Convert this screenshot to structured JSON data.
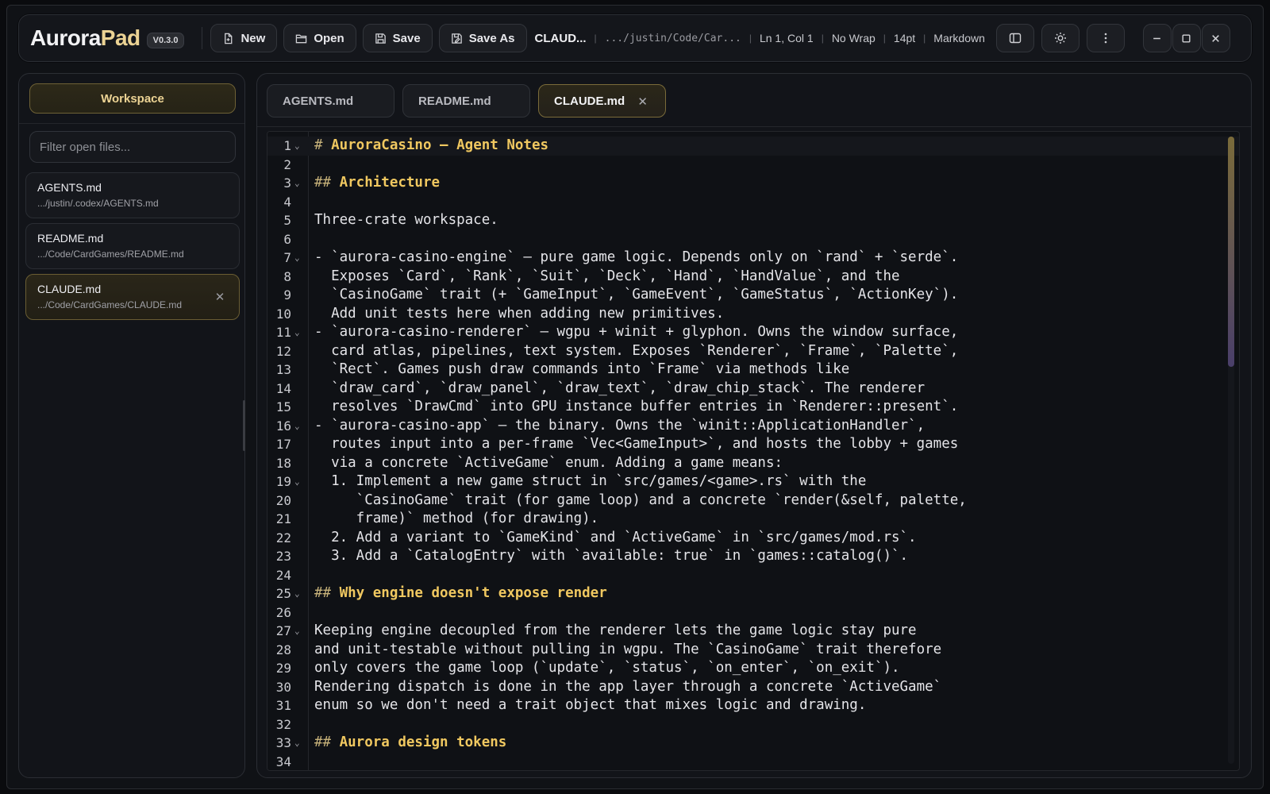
{
  "app": {
    "name_part1": "Aurora",
    "name_part2": "Pad",
    "version": "V0.3.0"
  },
  "toolbar": {
    "new_label": "New",
    "open_label": "Open",
    "save_label": "Save",
    "save_as_label": "Save As"
  },
  "status": {
    "file_name": "CLAUD...",
    "path": ".../justin/Code/Car...",
    "cursor": "Ln 1, Col 1",
    "wrap": "No Wrap",
    "font_size": "14pt",
    "language": "Markdown"
  },
  "sidebar": {
    "workspace_label": "Workspace",
    "filter_placeholder": "Filter open files...",
    "files": [
      {
        "name": "AGENTS.md",
        "path": ".../justin/.codex/AGENTS.md"
      },
      {
        "name": "README.md",
        "path": ".../Code/CardGames/README.md"
      },
      {
        "name": "CLAUDE.md",
        "path": ".../Code/CardGames/CLAUDE.md"
      }
    ]
  },
  "tabs": [
    {
      "label": "AGENTS.md"
    },
    {
      "label": "README.md"
    },
    {
      "label": "CLAUDE.md"
    }
  ],
  "colors": {
    "accent_gold": "#ecd394",
    "heading": "#f0c860",
    "background": "#101216"
  },
  "editor": {
    "lines": [
      {
        "n": "1",
        "fold": true,
        "heading": true,
        "marker": "#",
        "text": "AuroraCasino — Agent Notes"
      },
      {
        "n": "2",
        "text": ""
      },
      {
        "n": "3",
        "fold": true,
        "heading": true,
        "marker": "##",
        "text": "Architecture"
      },
      {
        "n": "4",
        "text": ""
      },
      {
        "n": "5",
        "text": "Three-crate workspace."
      },
      {
        "n": "6",
        "text": ""
      },
      {
        "n": "7",
        "fold": true,
        "text": "- `aurora-casino-engine` — pure game logic. Depends only on `rand` + `serde`."
      },
      {
        "n": "8",
        "text": "  Exposes `Card`, `Rank`, `Suit`, `Deck`, `Hand`, `HandValue`, and the"
      },
      {
        "n": "9",
        "text": "  `CasinoGame` trait (+ `GameInput`, `GameEvent`, `GameStatus`, `ActionKey`)."
      },
      {
        "n": "10",
        "text": "  Add unit tests here when adding new primitives."
      },
      {
        "n": "11",
        "fold": true,
        "text": "- `aurora-casino-renderer` — wgpu + winit + glyphon. Owns the window surface,"
      },
      {
        "n": "12",
        "text": "  card atlas, pipelines, text system. Exposes `Renderer`, `Frame`, `Palette`,"
      },
      {
        "n": "13",
        "text": "  `Rect`. Games push draw commands into `Frame` via methods like"
      },
      {
        "n": "14",
        "text": "  `draw_card`, `draw_panel`, `draw_text`, `draw_chip_stack`. The renderer"
      },
      {
        "n": "15",
        "text": "  resolves `DrawCmd` into GPU instance buffer entries in `Renderer::present`."
      },
      {
        "n": "16",
        "fold": true,
        "text": "- `aurora-casino-app` — the binary. Owns the `winit::ApplicationHandler`,"
      },
      {
        "n": "17",
        "text": "  routes input into a per-frame `Vec<GameInput>`, and hosts the lobby + games"
      },
      {
        "n": "18",
        "text": "  via a concrete `ActiveGame` enum. Adding a game means:"
      },
      {
        "n": "19",
        "fold": true,
        "text": "  1. Implement a new game struct in `src/games/<game>.rs` with the"
      },
      {
        "n": "20",
        "text": "     `CasinoGame` trait (for game loop) and a concrete `render(&self, palette,"
      },
      {
        "n": "21",
        "text": "     frame)` method (for drawing)."
      },
      {
        "n": "22",
        "text": "  2. Add a variant to `GameKind` and `ActiveGame` in `src/games/mod.rs`."
      },
      {
        "n": "23",
        "text": "  3. Add a `CatalogEntry` with `available: true` in `games::catalog()`."
      },
      {
        "n": "24",
        "text": ""
      },
      {
        "n": "25",
        "fold": true,
        "heading": true,
        "marker": "##",
        "text": "Why engine doesn't expose render"
      },
      {
        "n": "26",
        "text": ""
      },
      {
        "n": "27",
        "fold": true,
        "text": "Keeping engine decoupled from the renderer lets the game logic stay pure"
      },
      {
        "n": "28",
        "text": "and unit-testable without pulling in wgpu. The `CasinoGame` trait therefore"
      },
      {
        "n": "29",
        "text": "only covers the game loop (`update`, `status`, `on_enter`, `on_exit`)."
      },
      {
        "n": "30",
        "text": "Rendering dispatch is done in the app layer through a concrete `ActiveGame`"
      },
      {
        "n": "31",
        "text": "enum so we don't need a trait object that mixes logic and drawing."
      },
      {
        "n": "32",
        "text": ""
      },
      {
        "n": "33",
        "fold": true,
        "heading": true,
        "marker": "##",
        "text": "Aurora design tokens"
      },
      {
        "n": "34",
        "text": ""
      }
    ]
  }
}
